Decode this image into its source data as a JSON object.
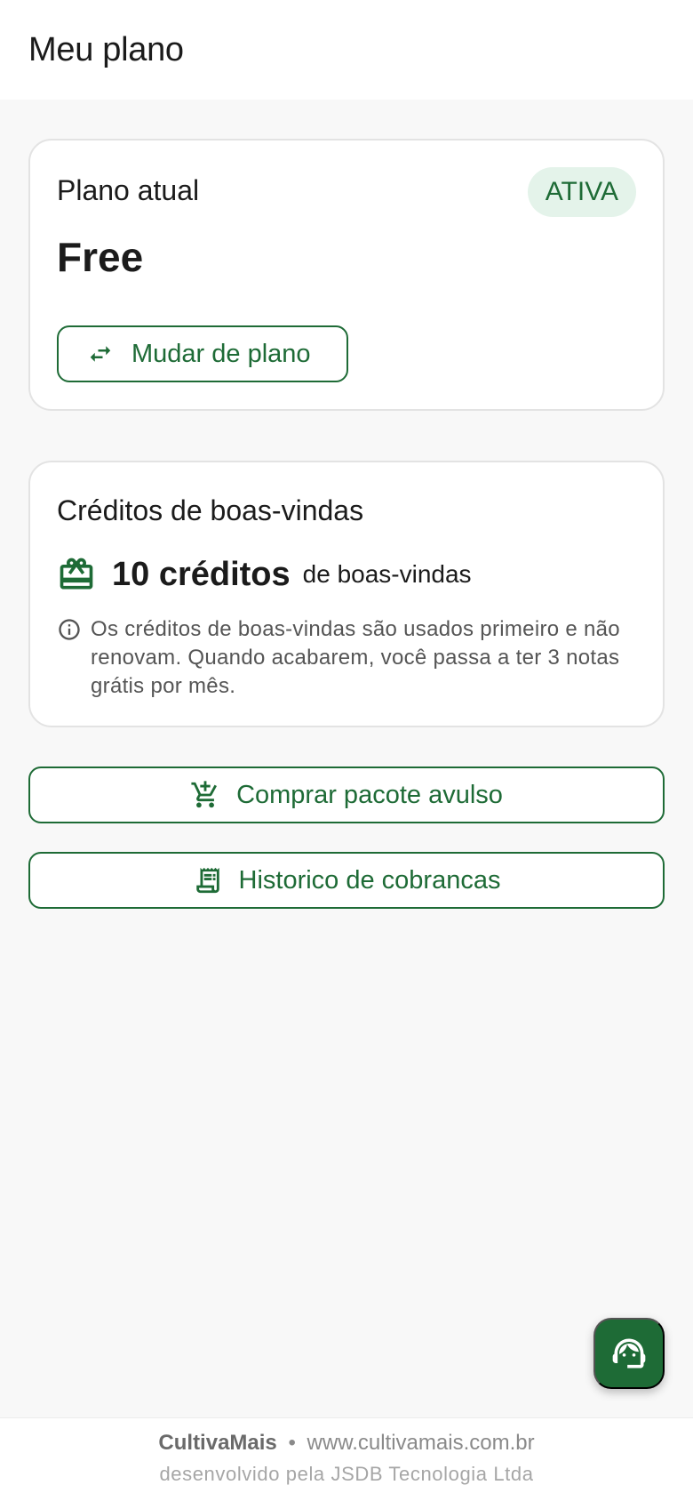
{
  "header": {
    "title": "Meu plano"
  },
  "plan_card": {
    "label": "Plano atual",
    "status": "ATIVA",
    "plan_name": "Free",
    "change_button": "Mudar de plano"
  },
  "credits_card": {
    "title": "Créditos de boas-vindas",
    "amount": "10 créditos",
    "suffix": "de boas-vindas",
    "note": "Os créditos de boas-vindas são usados primeiro e não renovam. Quando acabarem, você passa a ter 3 notas grátis por mês."
  },
  "actions": {
    "buy_pack": "Comprar pacote avulso",
    "billing_history": "Historico de cobrancas"
  },
  "footer": {
    "brand": "CultivaMais",
    "separator": "•",
    "url": "www.cultivamais.com.br",
    "credit": "desenvolvido pela JSDB Tecnologia Ltda"
  },
  "icons": {
    "swap": "swap-horiz-icon",
    "gift": "gift-card-icon",
    "info": "info-icon",
    "cart": "add-shopping-cart-icon",
    "receipt": "receipt-long-icon",
    "support": "support-agent-icon"
  },
  "colors": {
    "accent": "#1e6b36",
    "badge_bg": "#e4f3ea",
    "background": "#f8f8f8"
  }
}
